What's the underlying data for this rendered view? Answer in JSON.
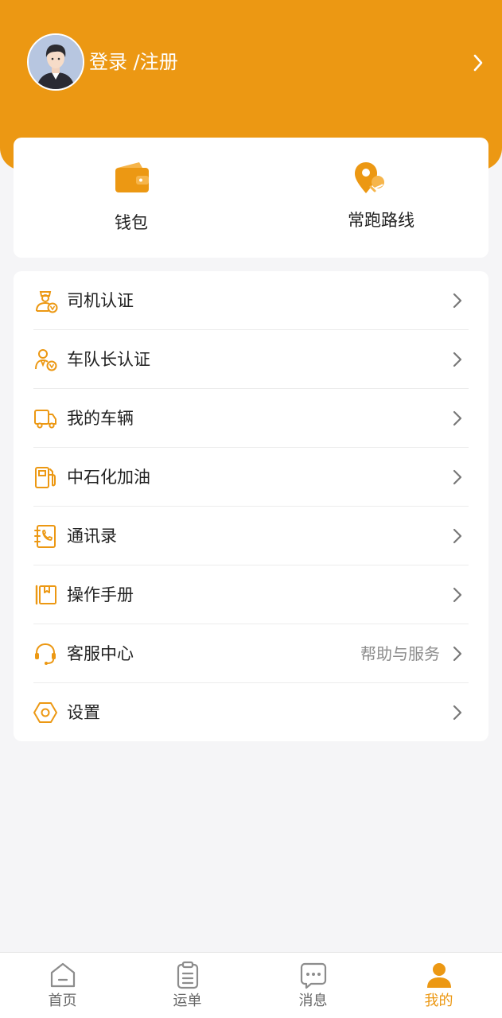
{
  "header": {
    "login_label": "登录 /注册"
  },
  "quick_actions": [
    {
      "label": "钱包",
      "icon": "wallet-icon"
    },
    {
      "label": "常跑路线",
      "icon": "route-pin-icon"
    }
  ],
  "menu": {
    "items": [
      {
        "label": "司机认证",
        "icon": "driver-badge-icon",
        "hint": ""
      },
      {
        "label": "车队长认证",
        "icon": "captain-badge-icon",
        "hint": ""
      },
      {
        "label": "我的车辆",
        "icon": "truck-icon",
        "hint": ""
      },
      {
        "label": "中石化加油",
        "icon": "fuel-pump-icon",
        "hint": ""
      },
      {
        "label": "通讯录",
        "icon": "contact-book-icon",
        "hint": ""
      },
      {
        "label": "操作手册",
        "icon": "manual-book-icon",
        "hint": ""
      },
      {
        "label": "客服中心",
        "icon": "headset-icon",
        "hint": "帮助与服务"
      },
      {
        "label": "设置",
        "icon": "settings-hex-icon",
        "hint": ""
      }
    ]
  },
  "tabbar": {
    "tabs": [
      {
        "label": "首页",
        "icon": "home-icon",
        "active": false
      },
      {
        "label": "运单",
        "icon": "clipboard-icon",
        "active": false
      },
      {
        "label": "消息",
        "icon": "message-icon",
        "active": false
      },
      {
        "label": "我的",
        "icon": "profile-icon",
        "active": true
      }
    ]
  },
  "colors": {
    "brand": "#ec9813",
    "text_primary": "#222222",
    "text_secondary": "#8c8c8c",
    "tab_inactive": "#666666",
    "background": "#f5f5f7"
  }
}
